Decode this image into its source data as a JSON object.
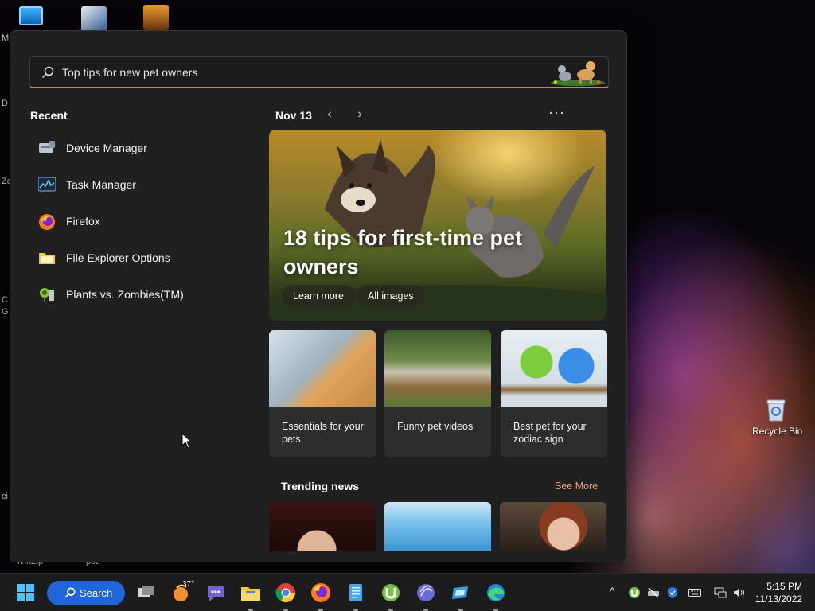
{
  "desktop": {
    "icons": [
      {
        "name": "this-pc",
        "color": "#1a8fe0"
      },
      {
        "name": "shortcut",
        "color": "#3b6fb0"
      },
      {
        "name": "game",
        "color": "#c47a20"
      }
    ],
    "edge_labels": [
      "M",
      "D",
      "Zo",
      "C",
      "G",
      "ci"
    ],
    "bottom_labels": [
      "WinZip",
      "psz"
    ],
    "recycle_bin_label": "Recycle Bin"
  },
  "search": {
    "value": "Top tips for new pet owners",
    "accent": "#e0824f"
  },
  "recent": {
    "title": "Recent",
    "items": [
      {
        "label": "Device Manager",
        "icon": "device-manager-icon"
      },
      {
        "label": "Task Manager",
        "icon": "task-manager-icon"
      },
      {
        "label": "Firefox",
        "icon": "firefox-icon"
      },
      {
        "label": "File Explorer Options",
        "icon": "folder-options-icon"
      },
      {
        "label": "Plants vs. Zombies(TM)",
        "icon": "plants-vs-zombies-icon"
      }
    ]
  },
  "highlights": {
    "date": "Nov 13",
    "prev_glyph": "‹",
    "next_glyph": "›",
    "more_glyph": "···",
    "hero": {
      "title": "18 tips for first-time pet owners",
      "learn_more": "Learn more",
      "all_images": "All images"
    },
    "cards": [
      {
        "caption": "Essentials for your pets"
      },
      {
        "caption": "Funny pet videos"
      },
      {
        "caption": "Best pet for your zodiac sign"
      }
    ],
    "trending_title": "Trending news",
    "see_more": "See More"
  },
  "taskbar": {
    "search_label": "Search",
    "weather_temp": "37°",
    "time": "5:15 PM",
    "date": "11/13/2022",
    "tray_chevron": "^"
  }
}
